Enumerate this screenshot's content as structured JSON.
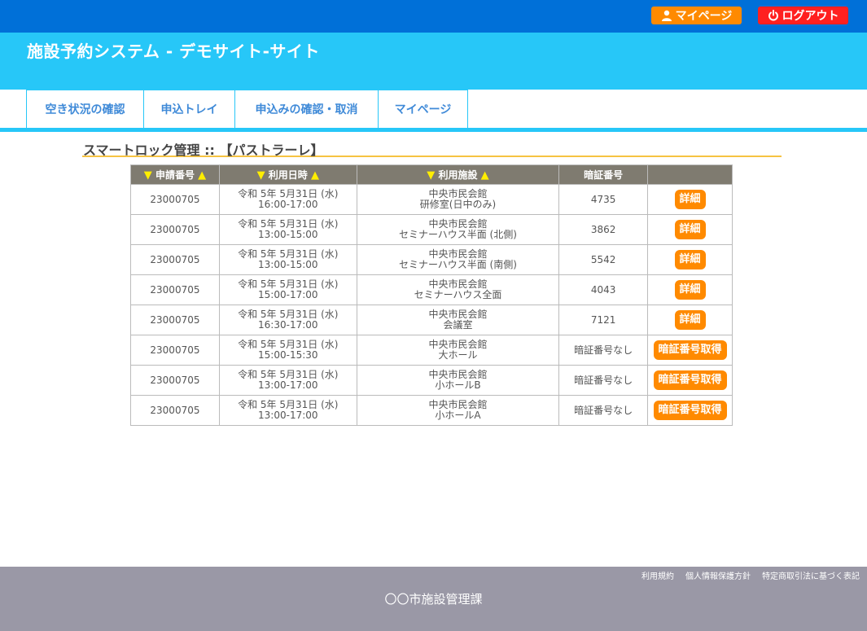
{
  "header": {
    "mypage_label": "マイページ",
    "logout_label": "ログアウト",
    "site_title": "施設予約システム - デモサイト-サイト"
  },
  "nav": {
    "items": [
      {
        "label": "空き状況の確認"
      },
      {
        "label": "申込トレイ"
      },
      {
        "label": "申込みの確認・取消"
      },
      {
        "label": "マイページ"
      }
    ]
  },
  "page": {
    "section_title": "スマートロック管理 :: 【パストラーレ】"
  },
  "table": {
    "headers": {
      "app_no": "申請番号",
      "date": "利用日時",
      "facility": "利用施設",
      "pin": "暗証番号"
    },
    "sort_marker_down": "▼",
    "sort_marker_up": "▲",
    "rows": [
      {
        "app_no": "23000705",
        "date1": "令和 5年 5月31日 (水)",
        "date2": "16:00-17:00",
        "fac1": "中央市民会館",
        "fac2": "研修室(日中のみ)",
        "pin": "4735",
        "action": "詳細"
      },
      {
        "app_no": "23000705",
        "date1": "令和 5年 5月31日 (水)",
        "date2": "13:00-15:00",
        "fac1": "中央市民会館",
        "fac2": "セミナーハウス半面 (北側)",
        "pin": "3862",
        "action": "詳細"
      },
      {
        "app_no": "23000705",
        "date1": "令和 5年 5月31日 (水)",
        "date2": "13:00-15:00",
        "fac1": "中央市民会館",
        "fac2": "セミナーハウス半面 (南側)",
        "pin": "5542",
        "action": "詳細"
      },
      {
        "app_no": "23000705",
        "date1": "令和 5年 5月31日 (水)",
        "date2": "15:00-17:00",
        "fac1": "中央市民会館",
        "fac2": "セミナーハウス全面",
        "pin": "4043",
        "action": "詳細"
      },
      {
        "app_no": "23000705",
        "date1": "令和 5年 5月31日 (水)",
        "date2": "16:30-17:00",
        "fac1": "中央市民会館",
        "fac2": "会議室",
        "pin": "7121",
        "action": "詳細"
      },
      {
        "app_no": "23000705",
        "date1": "令和 5年 5月31日 (水)",
        "date2": "15:00-15:30",
        "fac1": "中央市民会館",
        "fac2": "大ホール",
        "pin": "暗証番号なし",
        "action": "暗証番号取得"
      },
      {
        "app_no": "23000705",
        "date1": "令和 5年 5月31日 (水)",
        "date2": "13:00-17:00",
        "fac1": "中央市民会館",
        "fac2": "小ホールB",
        "pin": "暗証番号なし",
        "action": "暗証番号取得"
      },
      {
        "app_no": "23000705",
        "date1": "令和 5年 5月31日 (水)",
        "date2": "13:00-17:00",
        "fac1": "中央市民会館",
        "fac2": "小ホールA",
        "pin": "暗証番号なし",
        "action": "暗証番号取得"
      }
    ]
  },
  "footer": {
    "links": [
      {
        "label": "利用規約"
      },
      {
        "label": "個人情報保護方針"
      },
      {
        "label": "特定商取引法に基づく表記"
      }
    ],
    "org": "〇〇市施設管理課"
  },
  "colors": {
    "topbar": "#0070d8",
    "titlebar": "#27c7f8",
    "accent_orange": "#ff8a00",
    "logout_red": "#ff2020",
    "table_header": "#7f7b70",
    "footer": "#9a98a6"
  }
}
